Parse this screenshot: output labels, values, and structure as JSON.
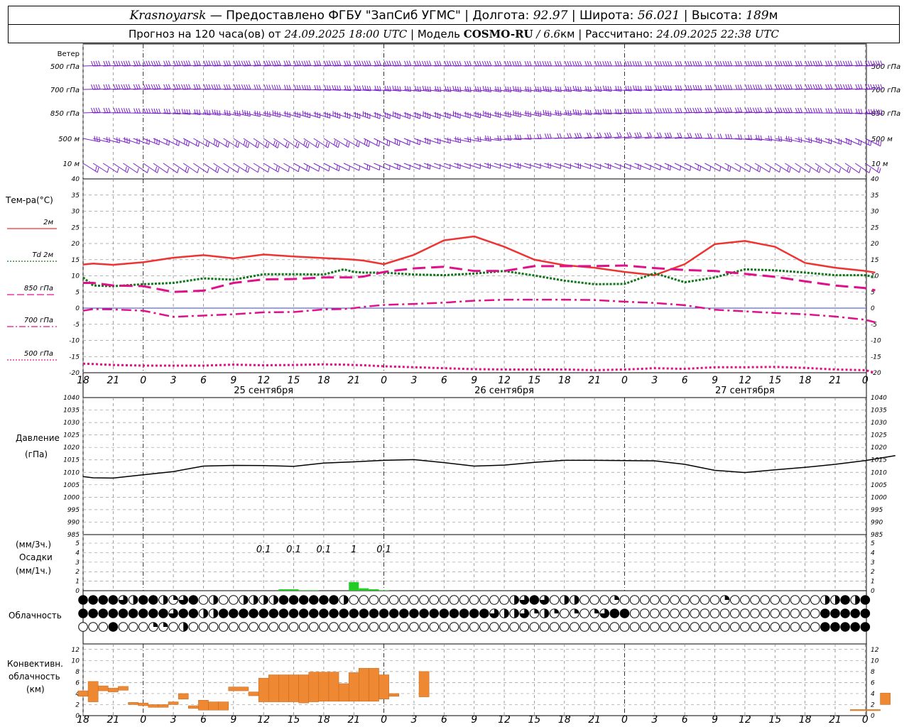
{
  "header": {
    "station": "Krasnoyarsk",
    "provider": "— Предоставлено ФГБУ \"ЗапСиб УГМС\" |",
    "lon_label": "Долгота:",
    "lon": "92.97",
    "lat_label": "| Широта:",
    "lat": "56.021",
    "alt_label": "| Высота:",
    "alt": "189",
    "alt_unit": "м",
    "forecast_label": "Прогноз на 120 часа(ов) от",
    "start_time": "24.09.2025 18:00 UTC",
    "model_label": "| Модель",
    "model": "COSMO-RU",
    "res": "/ 6.6",
    "res_unit": "км",
    "calc_label": "| Рассчитано:",
    "calc_time": "24.09.2025 22:38 UTC"
  },
  "panels": {
    "wind": {
      "title": "Ветер",
      "levels": [
        "500 гПа",
        "700 гПа",
        "850 гПа",
        "500 м",
        "10  м"
      ],
      "barb_color": "#7a22c8"
    },
    "temperature": {
      "title": "Тем-ра(°C)",
      "legend": [
        {
          "label": "2м",
          "color": "#ee3333",
          "style": "solid"
        },
        {
          "label": "Td  2м",
          "color": "#11771a",
          "style": "dotted"
        },
        {
          "label": "850 гПа",
          "color": "#e0108a",
          "style": "long-dash"
        },
        {
          "label": "700 гПа",
          "color": "#e0108a",
          "style": "dash-dot"
        },
        {
          "label": "500 гПа",
          "color": "#e0108a",
          "style": "dotted"
        }
      ]
    },
    "pressure": {
      "title": "Давление",
      "unit": "(гПа)"
    },
    "precip": {
      "unit_top": "(мм/3ч.)",
      "title": "Осадки",
      "unit_bottom": "(мм/1ч.)",
      "labels": [
        {
          "hour": 18,
          "text": "0.1"
        },
        {
          "hour": 21,
          "text": "0.1"
        },
        {
          "hour": 24,
          "text": "0.1"
        },
        {
          "hour": 27,
          "text": "1"
        },
        {
          "hour": 30,
          "text": "0.1"
        }
      ],
      "color": "#22cc22"
    },
    "cloud": {
      "title": "Облачность"
    },
    "convective": {
      "title_lines": [
        "Конвективн.",
        "облачность",
        "(км)"
      ],
      "color": "#ee8833"
    }
  },
  "x_axis": {
    "tick_labels": [
      "18",
      "21",
      "0",
      "3",
      "6",
      "9",
      "12",
      "15",
      "18",
      "21",
      "0",
      "3",
      "6",
      "9",
      "12",
      "15",
      "18",
      "21",
      "0",
      "3",
      "6",
      "9",
      "12",
      "15",
      "18",
      "21",
      "0"
    ],
    "dates": [
      {
        "hour": 18,
        "label": "25 сентября"
      },
      {
        "hour": 42,
        "label": "26 сентября"
      },
      {
        "hour": 66,
        "label": "27 сентября"
      }
    ]
  },
  "chart_data": [
    {
      "type": "line",
      "title": "Тем-ра(°C)",
      "ylim": [
        -20,
        40
      ],
      "x_unit": "hours from 24.09.2025 18:00 UTC",
      "x": [
        0,
        1,
        3,
        6,
        9,
        12,
        15,
        18,
        21,
        24,
        26,
        27,
        28,
        30,
        33,
        36,
        39,
        42,
        45,
        48,
        51,
        54,
        57,
        60,
        63,
        66,
        69,
        72,
        75,
        78,
        79
      ],
      "series": [
        {
          "name": "2м",
          "values": [
            13.5,
            13.8,
            13.4,
            14.2,
            15.6,
            16.4,
            15.4,
            16.6,
            16.0,
            15.5,
            15.2,
            15.0,
            14.7,
            13.6,
            16.5,
            21.0,
            22.2,
            19.0,
            15.0,
            13.3,
            12.5,
            11.2,
            10.2,
            13.6,
            19.8,
            20.8,
            19.0,
            14.0,
            12.5,
            11.5,
            11.0
          ]
        },
        {
          "name": "Td  2м",
          "values": [
            9.5,
            7.0,
            6.8,
            7.4,
            7.8,
            9.2,
            8.8,
            10.5,
            10.5,
            10.4,
            12.0,
            11.2,
            11.0,
            11.0,
            10.4,
            10.2,
            10.7,
            11.5,
            10.1,
            8.5,
            7.4,
            7.5,
            10.8,
            8.0,
            9.5,
            12.0,
            11.7,
            11.0,
            10.2,
            10.2,
            9.6
          ]
        },
        {
          "name": "850 гПа",
          "values": [
            7.8,
            7.8,
            7.0,
            6.8,
            5.0,
            5.4,
            7.8,
            8.9,
            9.0,
            9.5,
            9.5,
            9.5,
            9.8,
            11.2,
            12.3,
            12.8,
            11.5,
            11.5,
            13.0,
            13.0,
            13.0,
            13.2,
            12.4,
            11.8,
            11.5,
            10.6,
            9.7,
            8.3,
            7.0,
            6.2,
            5.5
          ]
        },
        {
          "name": "700 гПа",
          "values": [
            -0.8,
            -0.3,
            -0.4,
            -0.8,
            -2.7,
            -2.3,
            -1.9,
            -1.3,
            -1.2,
            -0.4,
            -0.3,
            0.0,
            0.4,
            1.0,
            1.3,
            1.7,
            2.3,
            2.6,
            2.6,
            2.6,
            2.5,
            2.0,
            1.6,
            0.9,
            -0.5,
            -1.0,
            -1.5,
            -1.9,
            -2.6,
            -3.6,
            -4.4
          ]
        },
        {
          "name": "500 гПа",
          "values": [
            -17.2,
            -17.3,
            -17.6,
            -17.8,
            -17.8,
            -17.8,
            -17.5,
            -17.7,
            -17.6,
            -17.4,
            -17.5,
            -17.6,
            -17.7,
            -18.0,
            -18.3,
            -18.6,
            -18.9,
            -19.0,
            -19.0,
            -19.0,
            -19.2,
            -19.0,
            -18.6,
            -18.8,
            -18.3,
            -18.3,
            -18.2,
            -18.5,
            -19.0,
            -19.2,
            -20.0
          ]
        }
      ]
    },
    {
      "type": "line",
      "title": "Давление",
      "ylabel": "(гПа)",
      "ylim": [
        985,
        1040
      ],
      "x": [
        0,
        1,
        3,
        6,
        9,
        12,
        15,
        18,
        21,
        24,
        27,
        30,
        33,
        36,
        39,
        42,
        45,
        48,
        51,
        54,
        57,
        60,
        63,
        66,
        69,
        72,
        75,
        78,
        81
      ],
      "series": [
        {
          "name": "Давление",
          "values": [
            1008.3,
            1007.8,
            1007.7,
            1009.0,
            1010.3,
            1012.5,
            1012.8,
            1012.7,
            1012.4,
            1013.7,
            1014.2,
            1014.8,
            1015.1,
            1013.9,
            1012.5,
            1012.9,
            1014.0,
            1014.8,
            1014.8,
            1014.7,
            1014.6,
            1013.2,
            1010.8,
            1009.9,
            1011.0,
            1012.0,
            1013.2,
            1014.7,
            1016.7
          ]
        }
      ]
    },
    {
      "type": "bar",
      "title": "Осадки",
      "ylabel": "(мм/1ч.)",
      "ylim": [
        0,
        5
      ],
      "x": [
        20,
        21,
        22,
        23,
        27,
        28,
        29,
        30
      ],
      "values": [
        0.15,
        0.15,
        0.05,
        0.05,
        0.9,
        0.25,
        0.15,
        0.05
      ]
    },
    {
      "type": "bar",
      "title": "Конвективн. облачность (км)",
      "ylim": [
        0,
        13
      ],
      "bars": [
        [
          -0.5,
          0.5,
          3.5,
          4.5
        ],
        [
          0.5,
          1.5,
          2.5,
          6.2
        ],
        [
          1.5,
          2.5,
          4.5,
          5.4
        ],
        [
          2.5,
          3.5,
          4.3,
          5.0
        ],
        [
          3.5,
          4.5,
          4.6,
          5.3
        ],
        [
          4.5,
          5.5,
          2.0,
          2.4
        ],
        [
          5.5,
          6.5,
          1.8,
          2.3
        ],
        [
          6.5,
          7.5,
          1.5,
          2.0
        ],
        [
          7.5,
          8.5,
          1.5,
          2.0
        ],
        [
          8.5,
          9.5,
          2.0,
          2.5
        ],
        [
          9.5,
          10.5,
          3.0,
          4.0
        ],
        [
          10.5,
          11.5,
          1.3,
          1.8
        ],
        [
          11.5,
          12.5,
          1.0,
          2.8
        ],
        [
          12.5,
          13.5,
          1.0,
          2.5
        ],
        [
          13.5,
          14.5,
          1.0,
          2.5
        ],
        [
          14.5,
          16.5,
          4.5,
          5.2
        ],
        [
          16.5,
          17.5,
          3.6,
          4.3
        ],
        [
          17.5,
          18.5,
          2.5,
          6.8
        ],
        [
          18.5,
          19.5,
          2.5,
          7.4
        ],
        [
          19.5,
          20.5,
          2.5,
          7.4
        ],
        [
          20.5,
          21.5,
          2.5,
          7.4
        ],
        [
          21.5,
          22.5,
          2.3,
          7.4
        ],
        [
          22.5,
          23.5,
          2.5,
          7.9
        ],
        [
          23.5,
          24.5,
          2.6,
          7.9
        ],
        [
          24.5,
          25.5,
          2.6,
          7.9
        ],
        [
          25.5,
          26.5,
          2.6,
          5.8
        ],
        [
          26.5,
          27.5,
          2.6,
          7.8
        ],
        [
          27.5,
          28.5,
          2.6,
          8.6
        ],
        [
          28.5,
          29.5,
          2.6,
          8.6
        ],
        [
          29.5,
          30.5,
          3.0,
          7.4
        ],
        [
          30.5,
          31.5,
          3.5,
          4.0
        ],
        [
          33.5,
          34.5,
          3.4,
          8.0
        ],
        [
          76.5,
          79.5,
          0.9,
          1.1
        ],
        [
          79.5,
          80.5,
          2.0,
          4.1
        ]
      ]
    }
  ]
}
